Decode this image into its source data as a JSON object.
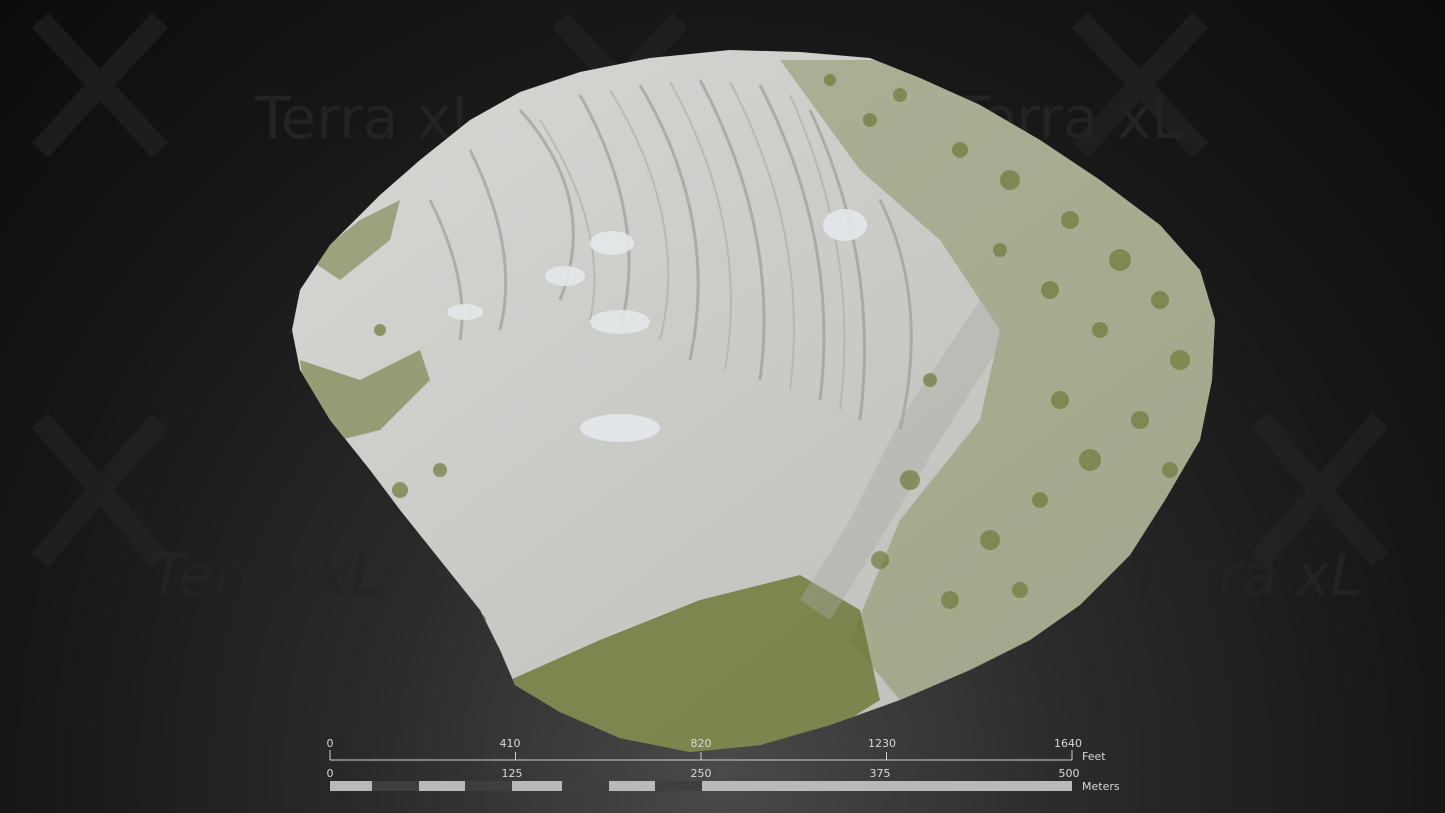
{
  "watermark": {
    "text": "Terra xL"
  },
  "colors": {
    "rock": "#cfcfcc",
    "rock_shadow": "#8f918d",
    "vegetation": "#6f7a3a",
    "scale_text": "#d8d8d8",
    "bar_light": "#b9b9b9",
    "bar_dark": "#3e3e3e"
  },
  "scale": {
    "feet": {
      "unit": "Feet",
      "ticks": [
        "0",
        "410",
        "820",
        "1230",
        "1640"
      ]
    },
    "meters": {
      "unit": "Meters",
      "ticks": [
        "0",
        "125",
        "250",
        "375",
        "500"
      ]
    }
  }
}
